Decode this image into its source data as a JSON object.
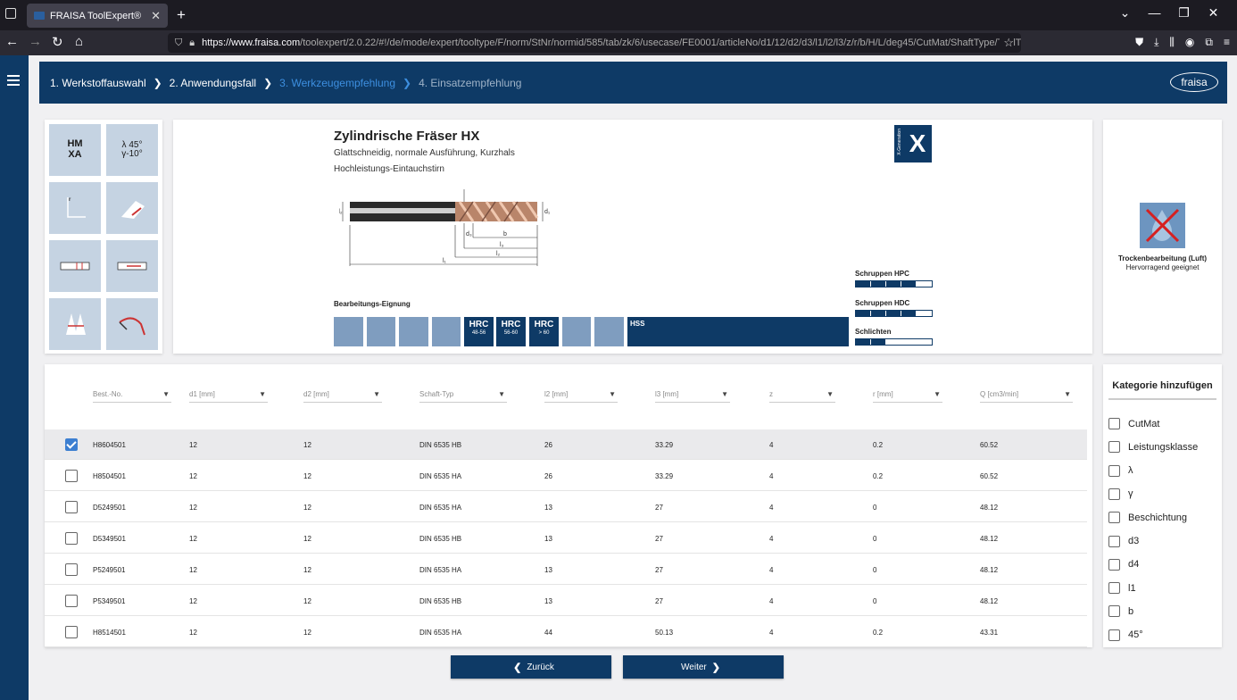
{
  "browser": {
    "tab_title": "FRAISA ToolExpert®",
    "tab_close": "✕",
    "new_tab": "+",
    "url_host": "https://www.fraisa.com",
    "url_path": "/toolexpert/2.0.22/#!/de/mode/expert/tooltype/F/norm/StNr/normid/585/tab/zk/6/usecase/FE0001/articleNo/d1/12/d2/d3/l1/l2/l3/z/r/b/H/L/deg45/CutMat/ShaftType/ToolType"
  },
  "breadcrumb": {
    "step1": "1. Werkstoffauswahl",
    "step2": "2. Anwendungsfall",
    "step3": "3. Werkzeugempfehlung",
    "step4": "4. Einsatzempfehlung"
  },
  "logo": "fraisa",
  "iconbox": {
    "cutmat": "HM\nXA",
    "angles_top": "λ 45°",
    "angles_bottom": "γ-10°"
  },
  "product": {
    "title": "Zylindrische Fräser HX",
    "subtitle1": "Glattschneidig, normale Ausführung, Kurzhals",
    "subtitle2": "Hochleistungs-Eintauchstirn",
    "xgen": "X",
    "xgen_label": "X-Generation",
    "suitability_label": "Bearbeitungs-Eignung",
    "hrc": [
      {
        "label": "HRC",
        "range": "48-56"
      },
      {
        "label": "HRC",
        "range": "56-60"
      },
      {
        "label": "HRC",
        "range": "> 60"
      }
    ],
    "hss": "HSS",
    "dim_labels": {
      "d1": "d₁",
      "d2": "d₂",
      "d3": "d₃",
      "l1": "l₁",
      "l2": "l₂",
      "l3": "l₃",
      "b": "b"
    },
    "bars": [
      {
        "label": "Schruppen HPC",
        "level": 4
      },
      {
        "label": "Schruppen HDC",
        "level": 4
      },
      {
        "label": "Schlichten",
        "level": 2
      }
    ]
  },
  "dry": {
    "title": "Trockenbearbeitung (Luft)",
    "sub": "Hervorragend geeignet"
  },
  "table": {
    "headers": [
      "Best.-No.",
      "d1 [mm]",
      "d2 [mm]",
      "Schaft-Typ",
      "l2 [mm]",
      "l3 [mm]",
      "z",
      "r [mm]",
      "Q [cm3/min]"
    ],
    "rows": [
      {
        "no": "H8604501",
        "d1": "12",
        "d2": "12",
        "shaft": "DIN 6535 HB",
        "l2": "26",
        "l3": "33.29",
        "z": "4",
        "r": "0.2",
        "q": "60.52"
      },
      {
        "no": "H8504501",
        "d1": "12",
        "d2": "12",
        "shaft": "DIN 6535 HA",
        "l2": "26",
        "l3": "33.29",
        "z": "4",
        "r": "0.2",
        "q": "60.52"
      },
      {
        "no": "D5249501",
        "d1": "12",
        "d2": "12",
        "shaft": "DIN 6535 HA",
        "l2": "13",
        "l3": "27",
        "z": "4",
        "r": "0",
        "q": "48.12"
      },
      {
        "no": "D5349501",
        "d1": "12",
        "d2": "12",
        "shaft": "DIN 6535 HB",
        "l2": "13",
        "l3": "27",
        "z": "4",
        "r": "0",
        "q": "48.12"
      },
      {
        "no": "P5249501",
        "d1": "12",
        "d2": "12",
        "shaft": "DIN 6535 HA",
        "l2": "13",
        "l3": "27",
        "z": "4",
        "r": "0",
        "q": "48.12"
      },
      {
        "no": "P5349501",
        "d1": "12",
        "d2": "12",
        "shaft": "DIN 6535 HB",
        "l2": "13",
        "l3": "27",
        "z": "4",
        "r": "0",
        "q": "48.12"
      },
      {
        "no": "H8514501",
        "d1": "12",
        "d2": "12",
        "shaft": "DIN 6535 HA",
        "l2": "44",
        "l3": "50.13",
        "z": "4",
        "r": "0.2",
        "q": "43.31"
      }
    ]
  },
  "category": {
    "title": "Kategorie hinzufügen",
    "items": [
      "CutMat",
      "Leistungsklasse",
      "λ",
      "γ",
      "Beschichtung",
      "d3",
      "d4",
      "l1",
      "b",
      "45°"
    ]
  },
  "buttons": {
    "back": "Zurück",
    "next": "Weiter"
  }
}
